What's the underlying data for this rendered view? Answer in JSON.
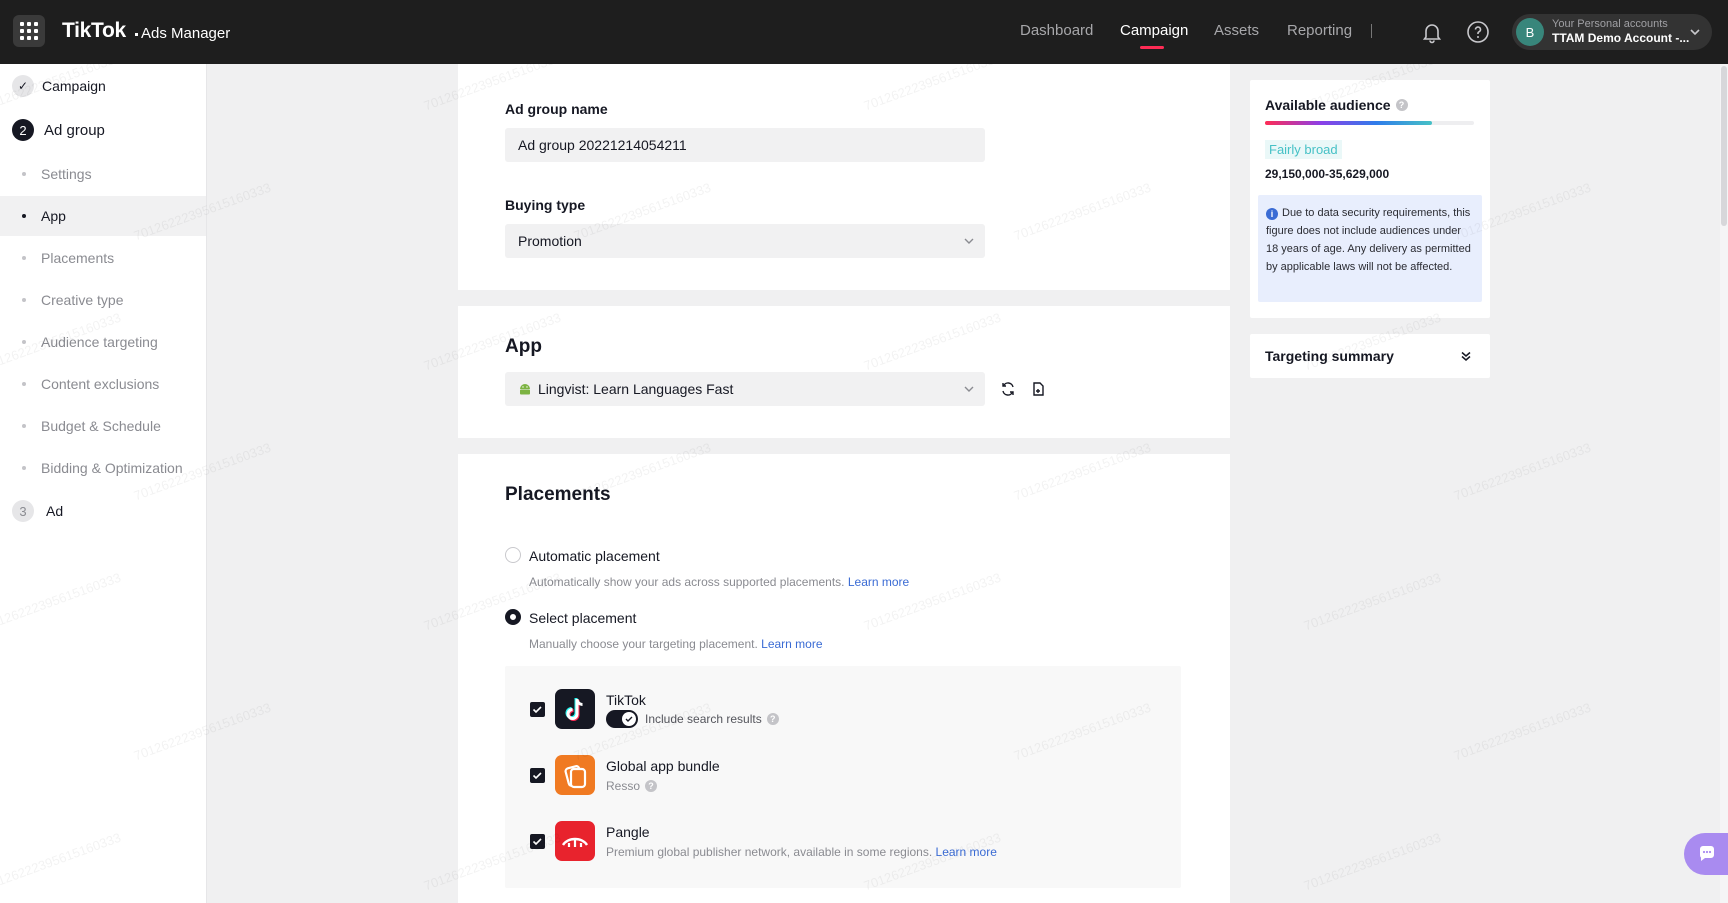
{
  "header": {
    "logo": "TikTok",
    "product": "Ads Manager",
    "nav": [
      "Dashboard",
      "Campaign",
      "Assets",
      "Reporting"
    ],
    "active_nav": "Campaign",
    "account": {
      "avatar": "B",
      "line1": "Your Personal accounts",
      "line2": "TTAM Demo Account -..."
    }
  },
  "sidebar": {
    "step1": {
      "num": "✓",
      "label": "Campaign"
    },
    "step2": {
      "num": "2",
      "label": "Ad group"
    },
    "items": [
      "Settings",
      "App",
      "Placements",
      "Creative type",
      "Audience targeting",
      "Content exclusions",
      "Budget & Schedule",
      "Bidding & Optimization"
    ],
    "active_item": "App",
    "step3": {
      "num": "3",
      "label": "Ad"
    }
  },
  "adgroup": {
    "name_label": "Ad group name",
    "name_value": "Ad group 20221214054211",
    "buying_label": "Buying type",
    "buying_value": "Promotion"
  },
  "app_section": {
    "title": "App",
    "selected_app": "Lingvist: Learn Languages Fast"
  },
  "placements": {
    "title": "Placements",
    "auto_label": "Automatic placement",
    "auto_desc": "Automatically show your ads across supported placements.",
    "select_label": "Select placement",
    "select_desc": "Manually choose your targeting placement.",
    "learn_more": "Learn more",
    "tiktok_name": "TikTok",
    "tiktok_toggle": "Include search results",
    "bundle_name": "Global app bundle",
    "bundle_sub": "Resso",
    "pangle_name": "Pangle",
    "pangle_sub": "Premium global publisher network, available in some regions."
  },
  "audience": {
    "title": "Available audience",
    "breadth": "Fairly broad",
    "breadth_level": 0.8,
    "range": "29,150,000-35,629,000",
    "notice": "Due to data security requirements, this figure does not include audiences under 18 years of age. Any delivery as permitted by applicable laws will not be affected.",
    "summary_title": "Targeting summary"
  },
  "watermark": "70126222395615160333",
  "colors": {
    "accent": "#fe2c55",
    "link": "#3a6bd4",
    "breadth_text": "#46c1c6",
    "notice_bg": "#e8eefd"
  }
}
